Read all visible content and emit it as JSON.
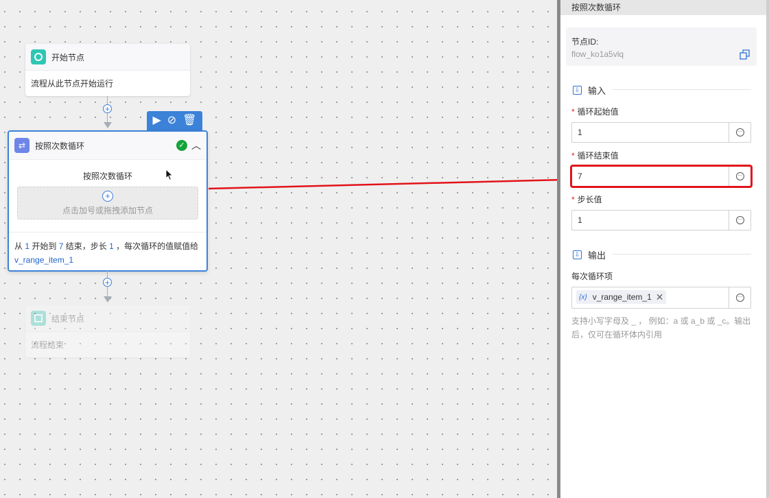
{
  "canvas": {
    "start_node": {
      "title": "开始节点",
      "desc": "流程从此节点开始运行"
    },
    "loop_node": {
      "title": "按照次数循环",
      "inner_title": "按照次数循环",
      "dropzone_text": "点击加号或拖拽添加节点",
      "summary": {
        "p1": "从 ",
        "start": "1",
        "p2": " 开始到 ",
        "end": "7",
        "p3": " 结束，步长 ",
        "step": "1",
        "p4": " ，每次循环的值赋值给",
        "var": "v_range_item_1"
      },
      "toolbar": [
        "run-icon",
        "disable-icon",
        "delete-icon"
      ]
    },
    "end_node": {
      "title": "结束节点",
      "desc": "流程结束"
    }
  },
  "panel": {
    "title": "按照次数循环",
    "node_id_label": "节点ID:",
    "node_id_value": "flow_ko1a5vlq",
    "input_section": "输入",
    "fields": [
      {
        "label": "循环起始值",
        "value": "1"
      },
      {
        "label": "循环结束值",
        "value": "7"
      },
      {
        "label": "步长值",
        "value": "1"
      }
    ],
    "output_section": "输出",
    "output_label": "每次循环项",
    "output_var_icon": "{x}",
    "output_tag": "v_range_item_1",
    "hint_line1": "支持小写字母及 _ ， 例如：a 或 a_b 或 _c。输出",
    "hint_line2": "后，仅可在循环体内引用"
  },
  "colors": {
    "accent": "#3b82d8",
    "highlight": "#e2131a",
    "success": "#17a33a"
  }
}
